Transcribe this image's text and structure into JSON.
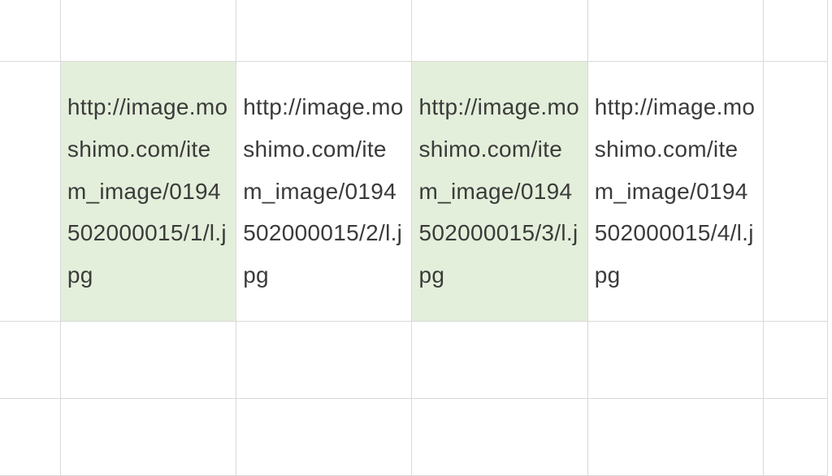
{
  "sheet": {
    "rows": [
      {
        "height": "short",
        "cells": [
          {
            "value": "",
            "highlight": false,
            "wide": false
          },
          {
            "value": "",
            "highlight": false,
            "wide": true
          },
          {
            "value": "",
            "highlight": false,
            "wide": true
          },
          {
            "value": "",
            "highlight": false,
            "wide": true
          },
          {
            "value": "",
            "highlight": false,
            "wide": true
          },
          {
            "value": "",
            "highlight": false,
            "wide": false
          }
        ]
      },
      {
        "height": "tall",
        "cells": [
          {
            "value": "",
            "highlight": false,
            "wide": false
          },
          {
            "value": "http://image.moshimo.com/item_image/0194502000015/1/l.jpg",
            "highlight": true,
            "wide": true
          },
          {
            "value": "http://image.moshimo.com/item_image/0194502000015/2/l.jpg",
            "highlight": false,
            "wide": true
          },
          {
            "value": "http://image.moshimo.com/item_image/0194502000015/3/l.jpg",
            "highlight": true,
            "wide": true
          },
          {
            "value": "http://image.moshimo.com/item_image/0194502000015/4/l.jpg",
            "highlight": false,
            "wide": true
          },
          {
            "value": "",
            "highlight": false,
            "wide": false
          }
        ]
      },
      {
        "height": "short",
        "cells": [
          {
            "value": "",
            "highlight": false,
            "wide": false
          },
          {
            "value": "",
            "highlight": false,
            "wide": true
          },
          {
            "value": "",
            "highlight": false,
            "wide": true
          },
          {
            "value": "",
            "highlight": false,
            "wide": true
          },
          {
            "value": "",
            "highlight": false,
            "wide": true
          },
          {
            "value": "",
            "highlight": false,
            "wide": false
          }
        ]
      },
      {
        "height": "short",
        "cells": [
          {
            "value": "",
            "highlight": false,
            "wide": false
          },
          {
            "value": "",
            "highlight": false,
            "wide": true
          },
          {
            "value": "",
            "highlight": false,
            "wide": true
          },
          {
            "value": "",
            "highlight": false,
            "wide": true
          },
          {
            "value": "",
            "highlight": false,
            "wide": true
          },
          {
            "value": "",
            "highlight": false,
            "wide": false
          }
        ]
      }
    ]
  }
}
